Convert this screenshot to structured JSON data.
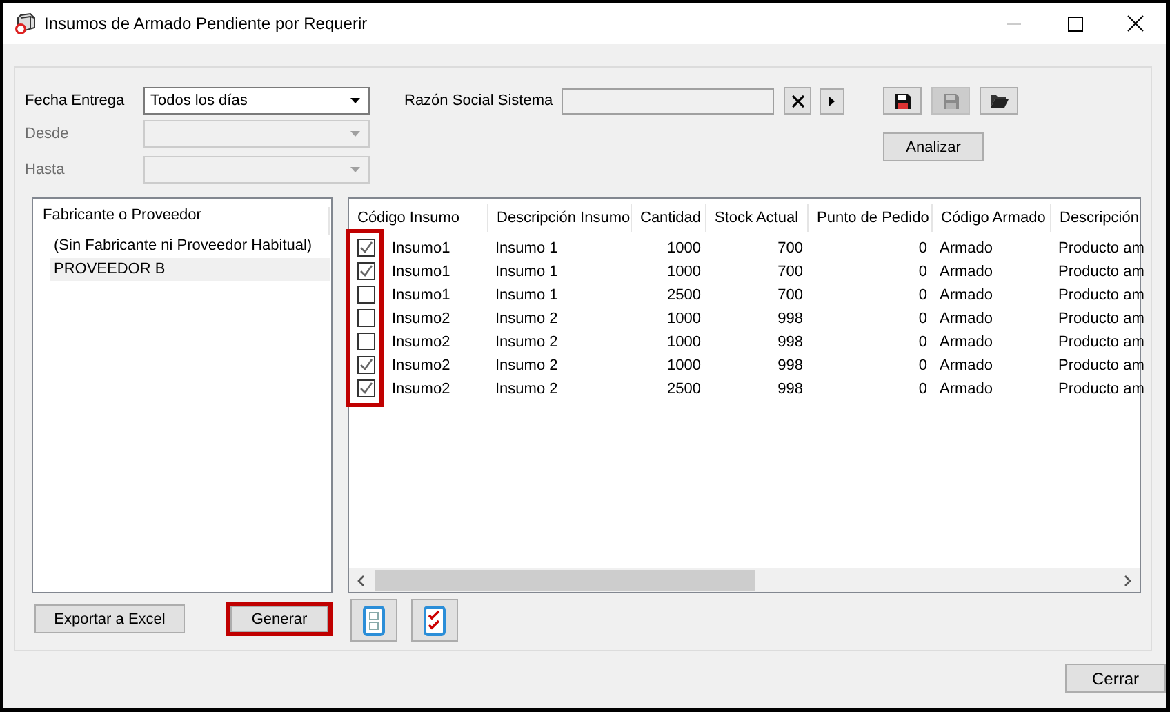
{
  "window": {
    "title": "Insumos de Armado Pendiente por Requerir"
  },
  "filters": [
    {
      "label": "Fecha Entrega",
      "value": "Todos los días",
      "disabled": false
    },
    {
      "label": "Desde",
      "disabled": true
    },
    {
      "label": "Hasta",
      "disabled": true
    }
  ],
  "razon_social": {
    "label": "Razón Social Sistema"
  },
  "toolbar": [
    {
      "kind": "save",
      "disabled": false
    },
    {
      "kind": "save",
      "disabled": true
    },
    {
      "kind": "open",
      "disabled": false
    }
  ],
  "analyze_button": "Analizar",
  "fabricantes": {
    "header": "Fabricante o Proveedor",
    "items": [
      {
        "label": "(Sin Fabricante ni Proveedor Habitual)",
        "selected": false
      },
      {
        "label": "PROVEEDOR B",
        "selected": true
      }
    ]
  },
  "table": {
    "columns": [
      "Código Insumo",
      "Descripción Insumo",
      "Cantidad",
      "Stock Actual",
      "Punto de Pedido",
      "Código Armado",
      "Descripción"
    ],
    "checkbox_column_highlighted": true,
    "rows": [
      {
        "checked": true,
        "cells": [
          "Insumo1",
          "Insumo 1",
          "1000",
          "700",
          "0",
          "Armado",
          "Producto am"
        ]
      },
      {
        "checked": true,
        "cells": [
          "Insumo1",
          "Insumo 1",
          "1000",
          "700",
          "0",
          "Armado",
          "Producto am"
        ]
      },
      {
        "checked": false,
        "cells": [
          "Insumo1",
          "Insumo 1",
          "2500",
          "700",
          "0",
          "Armado",
          "Producto am"
        ]
      },
      {
        "checked": false,
        "cells": [
          "Insumo2",
          "Insumo 2",
          "1000",
          "998",
          "0",
          "Armado",
          "Producto am"
        ]
      },
      {
        "checked": false,
        "cells": [
          "Insumo2",
          "Insumo 2",
          "1000",
          "998",
          "0",
          "Armado",
          "Producto am"
        ]
      },
      {
        "checked": true,
        "cells": [
          "Insumo2",
          "Insumo 2",
          "1000",
          "998",
          "0",
          "Armado",
          "Producto am"
        ]
      },
      {
        "checked": true,
        "cells": [
          "Insumo2",
          "Insumo 2",
          "2500",
          "998",
          "0",
          "Armado",
          "Producto am"
        ]
      }
    ]
  },
  "bottom_buttons": [
    {
      "label": "Exportar a Excel",
      "highlighted": false
    },
    {
      "label": "Generar",
      "highlighted": true
    }
  ],
  "icon_buttons": [
    {
      "kind": "page"
    },
    {
      "kind": "checklist"
    }
  ],
  "close_button": "Cerrar"
}
